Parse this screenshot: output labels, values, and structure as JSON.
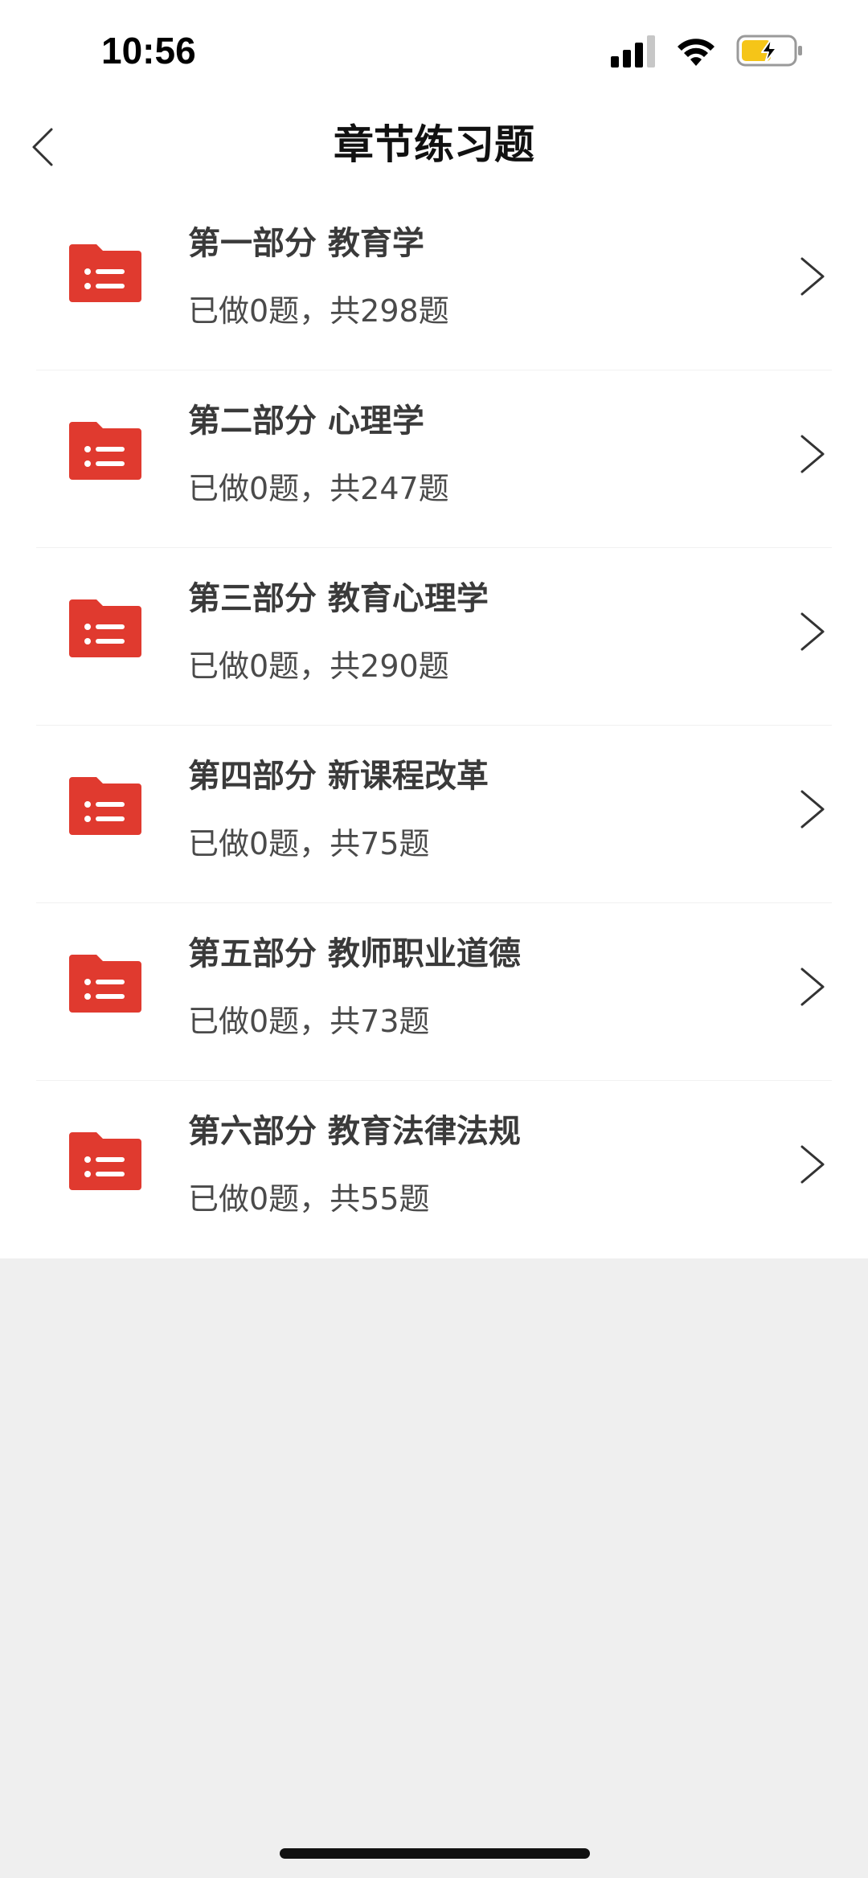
{
  "status_bar": {
    "time": "10:56",
    "icons": [
      "signal-icon",
      "wifi-icon",
      "battery-charging-icon"
    ],
    "battery_color": "#f5c518"
  },
  "nav": {
    "title": "章节练习题",
    "back_icon": "chevron-left-icon"
  },
  "accent_color": "#e03a2f",
  "chapters": [
    {
      "title": "第一部分 教育学",
      "progress": "已做0题，共298题"
    },
    {
      "title": "第二部分 心理学",
      "progress": "已做0题，共247题"
    },
    {
      "title": "第三部分 教育心理学",
      "progress": "已做0题，共290题"
    },
    {
      "title": "第四部分 新课程改革",
      "progress": "已做0题，共75题"
    },
    {
      "title": "第五部分 教师职业道德",
      "progress": "已做0题，共73题"
    },
    {
      "title": "第六部分 教育法律法规",
      "progress": "已做0题，共55题"
    }
  ]
}
